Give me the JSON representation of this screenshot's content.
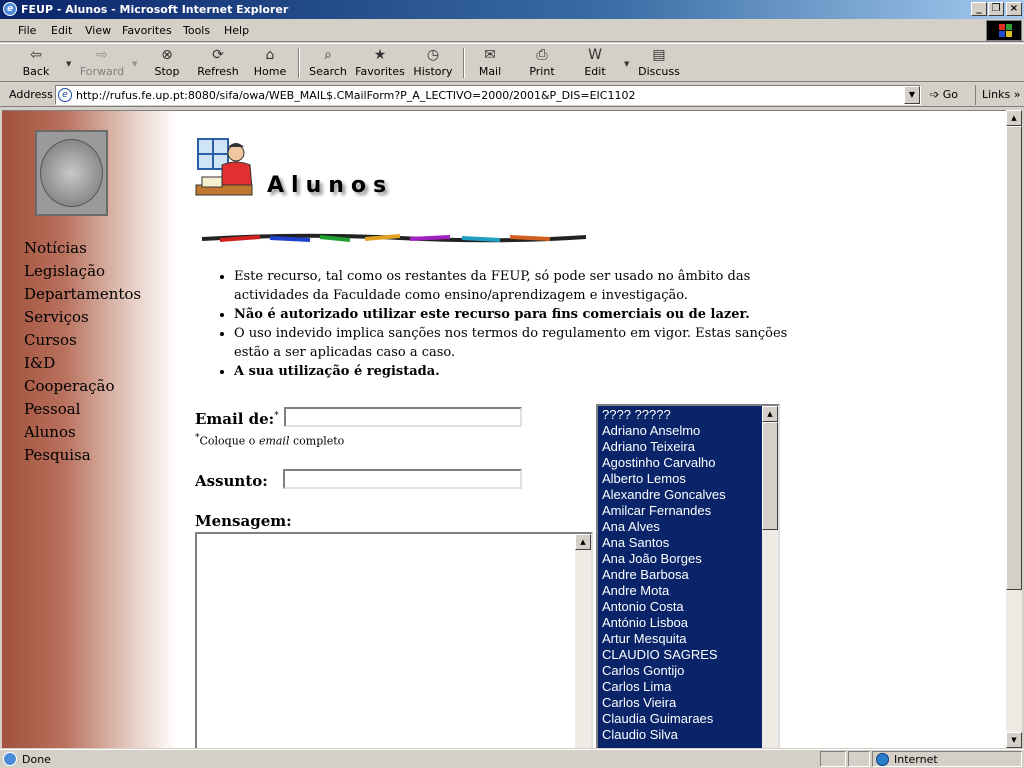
{
  "window": {
    "title": "FEUP - Alunos - Microsoft Internet Explorer"
  },
  "menu": [
    "File",
    "Edit",
    "View",
    "Favorites",
    "Tools",
    "Help"
  ],
  "toolbar": {
    "back": "Back",
    "forward": "Forward",
    "stop": "Stop",
    "refresh": "Refresh",
    "home": "Home",
    "search": "Search",
    "favorites": "Favorites",
    "history": "History",
    "mail": "Mail",
    "print": "Print",
    "edit": "Edit",
    "discuss": "Discuss"
  },
  "address": {
    "label": "Address",
    "url": "http://rufus.fe.up.pt:8080/sifa/owa/WEB_MAIL$.CMailForm?P_A_LECTIVO=2000/2001&P_DIS=EIC1102",
    "go": "Go",
    "links": "Links"
  },
  "sidebar": {
    "items": [
      "Notícias",
      "Legislação",
      "Departamentos",
      "Serviços",
      "Cursos",
      "I&D",
      "Cooperação",
      "Pessoal",
      "Alunos",
      "Pesquisa"
    ]
  },
  "page": {
    "title": "Alunos",
    "bullets": [
      "Este recurso, tal como os restantes da FEUP, só pode ser usado no âmbito das actividades da Faculdade como ensino/aprendizagem e investigação.",
      "Não é autorizado utilizar este recurso para fins comerciais ou de lazer.",
      "O uso indevido implica sanções nos termos do regulamento em vigor. Estas sanções estão a ser aplicadas caso a caso.",
      "A sua utilização é registada."
    ]
  },
  "form": {
    "email_label": "Email de:",
    "required_mark": "*",
    "note_prefix": "Coloque o ",
    "note_italic": "email",
    "note_suffix": " completo",
    "subject_label": "Assunto:",
    "message_label": "Mensagem:"
  },
  "recipients": [
    "???? ?????",
    "Adriano Anselmo",
    "Adriano Teixeira",
    "Agostinho Carvalho",
    "Alberto Lemos",
    "Alexandre Goncalves",
    "Amilcar Fernandes",
    "Ana Alves",
    "Ana Santos",
    "Ana João Borges",
    "Andre Barbosa",
    "Andre Mota",
    "Antonio Costa",
    "António Lisboa",
    "Artur Mesquita",
    "CLAUDIO SAGRES",
    "Carlos Gontijo",
    "Carlos Lima",
    "Carlos Vieira",
    "Claudia Guimaraes",
    "Claudio Silva"
  ],
  "status": {
    "text": "Done",
    "zone": "Internet"
  }
}
